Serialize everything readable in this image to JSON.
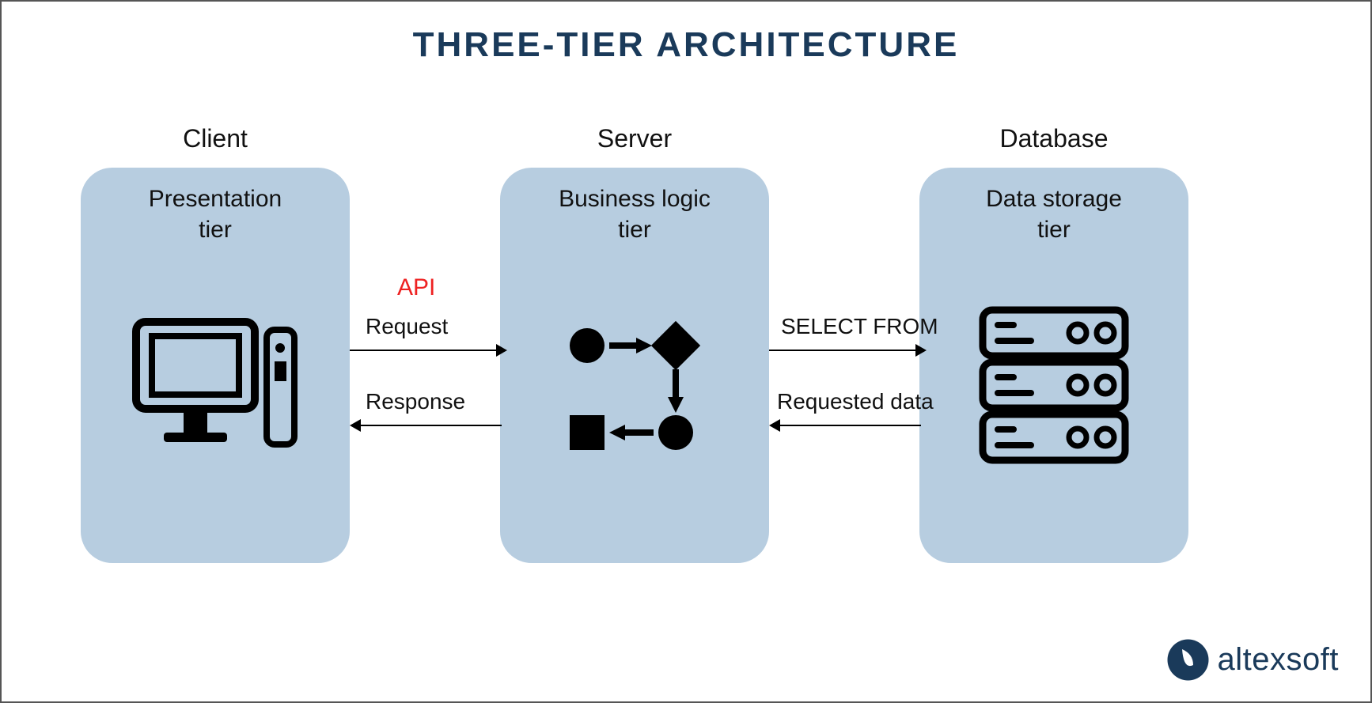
{
  "title": "THREE-TIER ARCHITECTURE",
  "tiers": [
    {
      "section": "Client",
      "name": "Presentation\ntier"
    },
    {
      "section": "Server",
      "name": "Business logic\ntier"
    },
    {
      "section": "Database",
      "name": "Data storage\ntier"
    }
  ],
  "api_label": "API",
  "connections": {
    "cs_request": "Request",
    "cs_response": "Response",
    "sd_select": "SELECT FROM",
    "sd_requested": "Requested data"
  },
  "logo_text": "altexsoft",
  "colors": {
    "tier_bg": "#b7cde0",
    "title": "#1a3a5a",
    "api": "#e22"
  }
}
